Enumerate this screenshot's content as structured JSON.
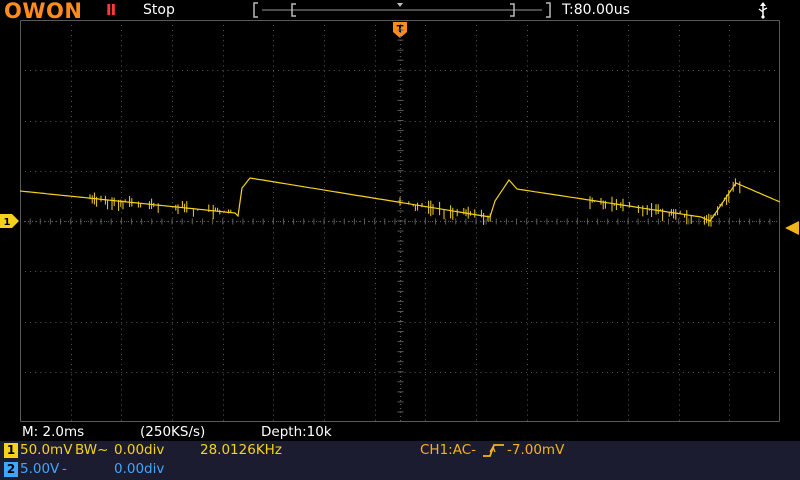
{
  "header": {
    "logo": "OWON",
    "run_state_icon": "II",
    "run_state": "Stop",
    "trigger_time": "T:80.00us",
    "usb_icon": "usb-icon"
  },
  "markers": {
    "trigger_position": "T",
    "ch1_ground": "1"
  },
  "status": {
    "timebase": "M: 2.0ms",
    "sample_rate": "(250KS/s)",
    "depth": "Depth:10k"
  },
  "channels": [
    {
      "badge": "1",
      "scale": "50.0mV",
      "coupling": "BW~",
      "offset": "0.00div",
      "color": "#f5d21b"
    },
    {
      "badge": "2",
      "scale": "5.00V",
      "coupling": "-",
      "offset": "0.00div",
      "color": "#3fa6ff"
    }
  ],
  "measurement": {
    "frequency": "28.0126KHz"
  },
  "trigger": {
    "source_coupling": "CH1:AC-",
    "edge_icon": "rising-edge-icon",
    "level": "-7.00mV",
    "color": "#f5b31b"
  },
  "colors": {
    "logo": "#ff8c1a",
    "ch1": "#f5d21b",
    "ch2": "#3fa6ff",
    "grid": "#5a5a5a",
    "info_panel_bg": "#1c1c30"
  }
}
